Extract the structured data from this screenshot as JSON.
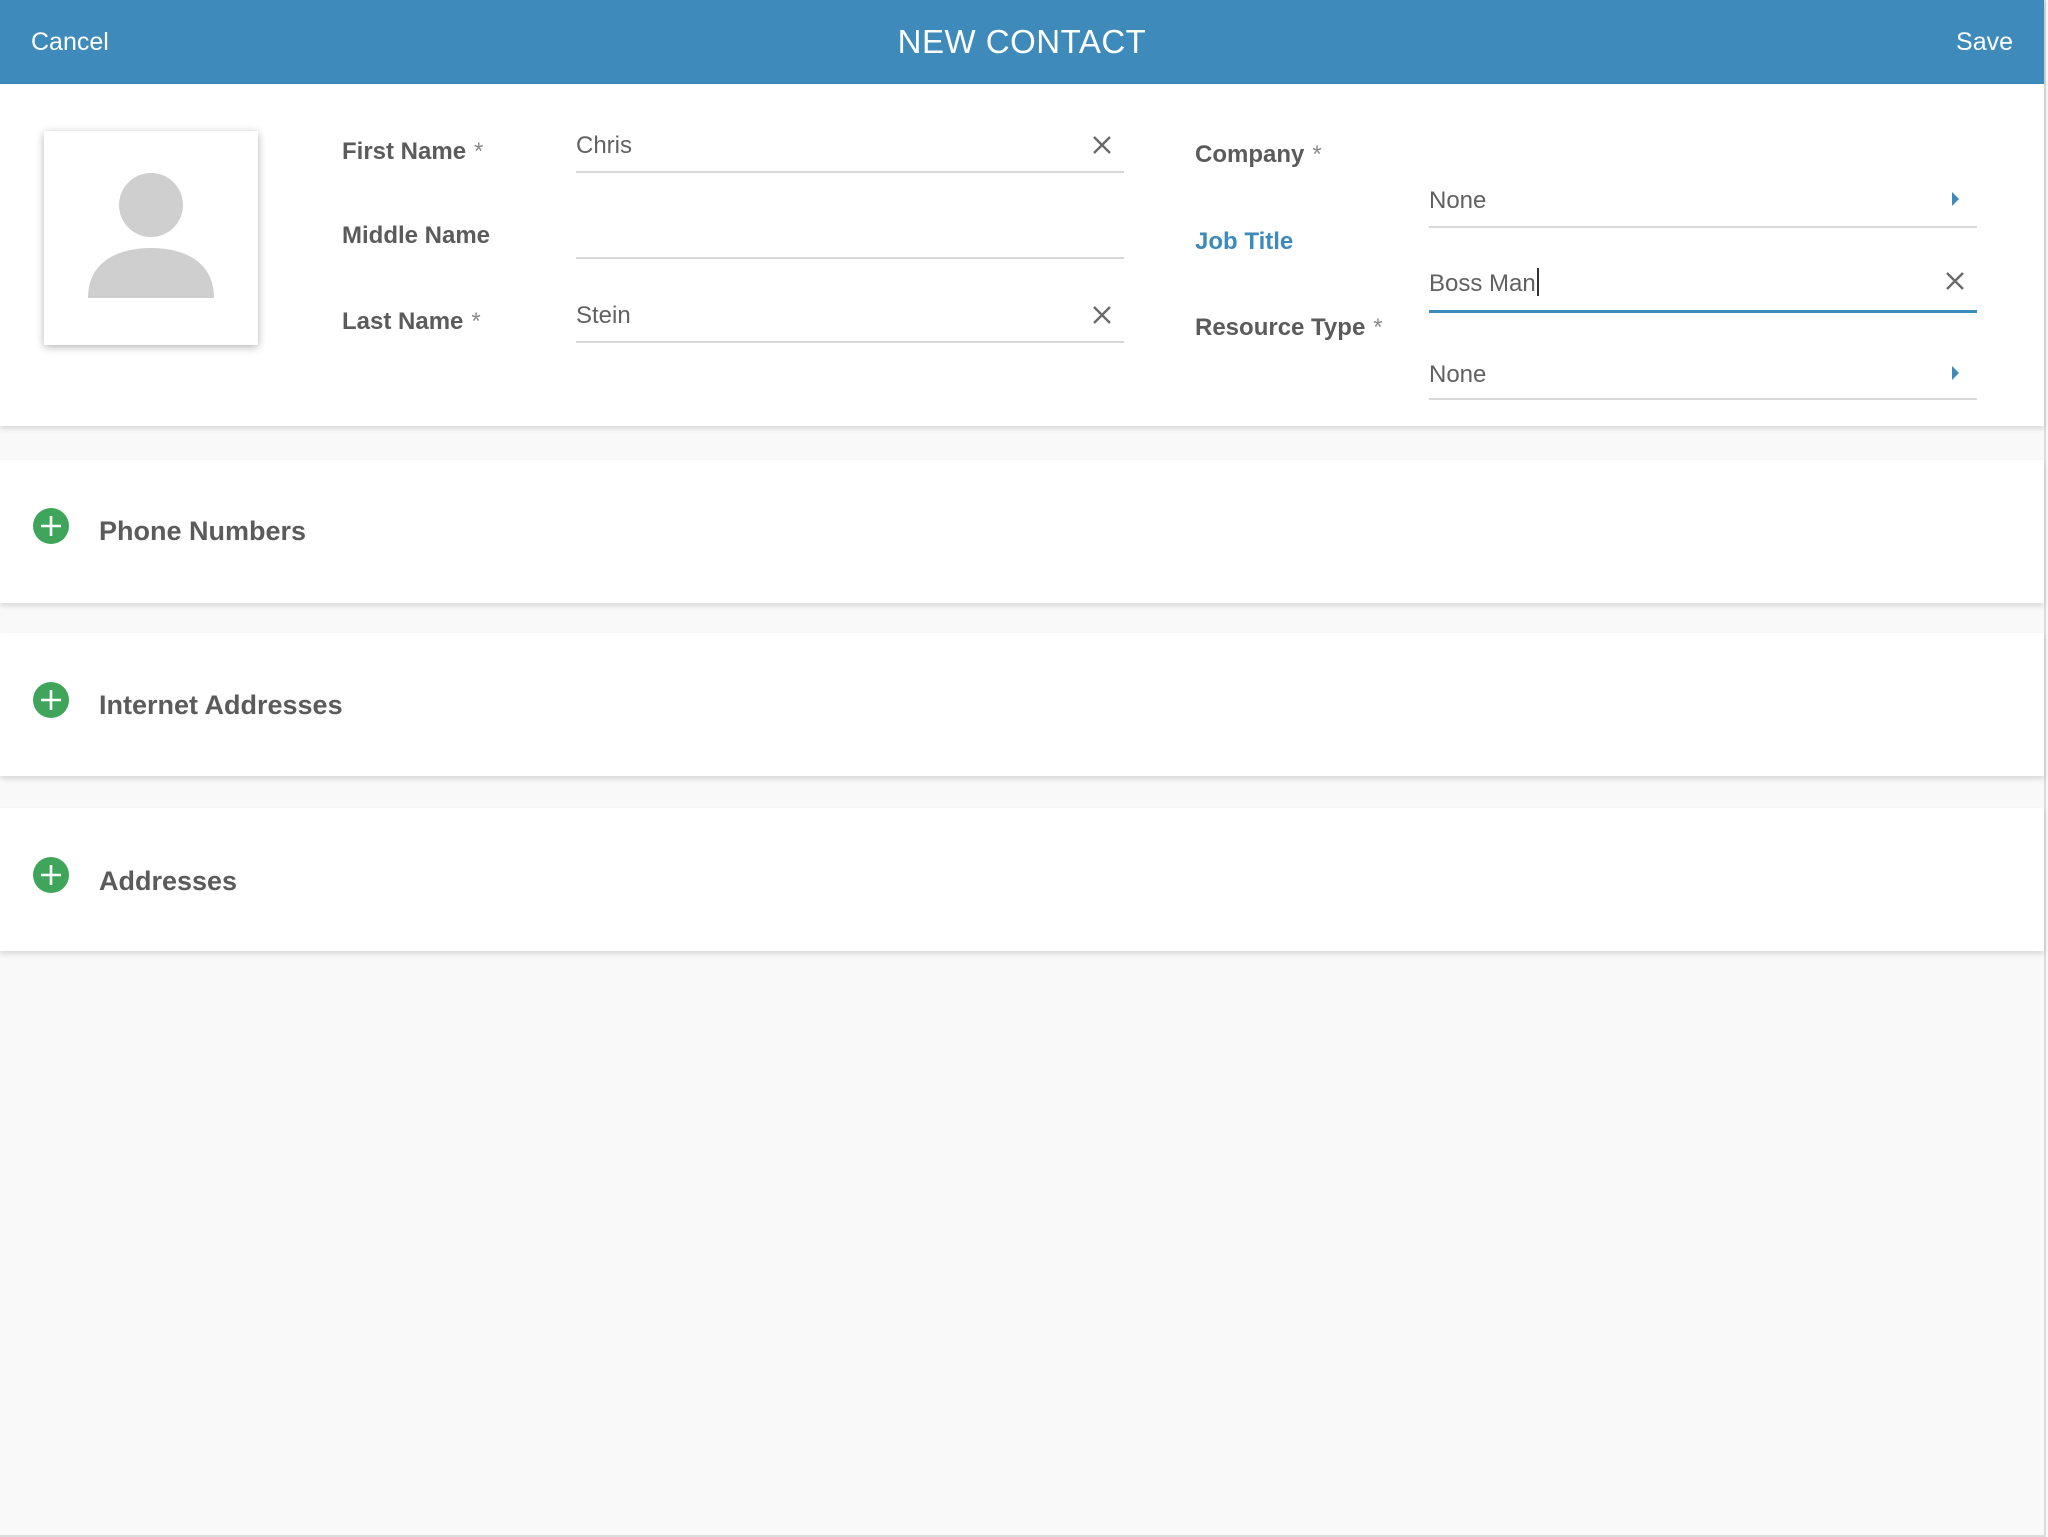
{
  "header": {
    "cancel_label": "Cancel",
    "title": "NEW CONTACT",
    "save_label": "Save"
  },
  "form": {
    "required_marker": "*",
    "first_name": {
      "label": "First Name",
      "value": "Chris"
    },
    "middle_name": {
      "label": "Middle Name",
      "value": ""
    },
    "last_name": {
      "label": "Last Name",
      "value": "Stein"
    },
    "company": {
      "label": "Company",
      "value": "None"
    },
    "job_title": {
      "label": "Job Title",
      "value": "Boss Man",
      "focused": true
    },
    "resource_type": {
      "label": "Resource Type",
      "value": "None"
    }
  },
  "sections": [
    {
      "title": "Phone Numbers"
    },
    {
      "title": "Internet Addresses"
    },
    {
      "title": "Addresses"
    }
  ],
  "icons": {
    "avatar": "person-placeholder-icon",
    "clear": "close-icon",
    "picker": "caret-right-icon",
    "add": "plus-circle-icon"
  },
  "colors": {
    "header_background": "#3d8abb",
    "accent": "#3d8abb",
    "add_button": "#3fa55a",
    "page_background": "#f9f9f9"
  }
}
